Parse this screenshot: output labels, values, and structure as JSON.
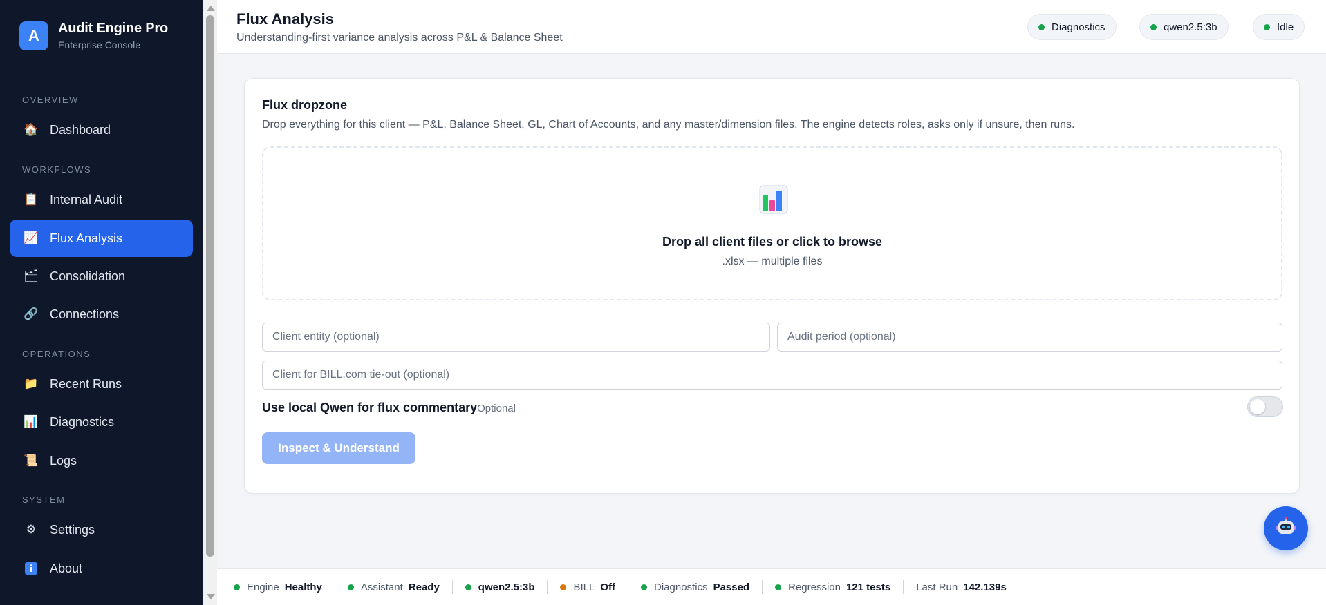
{
  "brand": {
    "logo_letter": "A",
    "name": "Audit Engine Pro",
    "subtitle": "Enterprise Console"
  },
  "sidebar": {
    "sections": [
      {
        "label": "OVERVIEW"
      },
      {
        "label": "WORKFLOWS"
      },
      {
        "label": "OPERATIONS"
      },
      {
        "label": "SYSTEM"
      }
    ],
    "items": [
      {
        "label": "Dashboard",
        "icon": "house-icon"
      },
      {
        "label": "Internal Audit",
        "icon": "clipboard-icon"
      },
      {
        "label": "Flux Analysis",
        "icon": "chart-up-icon",
        "active": true
      },
      {
        "label": "Consolidation",
        "icon": "folder-icon"
      },
      {
        "label": "Connections",
        "icon": "link-icon"
      },
      {
        "label": "Recent Runs",
        "icon": "folder-open-icon"
      },
      {
        "label": "Diagnostics",
        "icon": "bar-chart-icon"
      },
      {
        "label": "Logs",
        "icon": "scroll-icon"
      },
      {
        "label": "Settings",
        "icon": "gear-icon"
      },
      {
        "label": "About",
        "icon": "info-icon"
      }
    ]
  },
  "header": {
    "title": "Flux Analysis",
    "subtitle": "Understanding-first variance analysis across P&L & Balance Sheet",
    "pills": [
      {
        "label": "Diagnostics",
        "status": "green"
      },
      {
        "label": "qwen2.5:3b",
        "status": "green"
      },
      {
        "label": "Idle",
        "status": "green"
      }
    ]
  },
  "card": {
    "title": "Flux dropzone",
    "description": "Drop everything for this client — P&L, Balance Sheet, GL, Chart of Accounts, and any master/dimension files. The engine detects roles, asks only if unsure, then runs.",
    "dropzone": {
      "icon": "bar-chart-icon",
      "title": "Drop all client files or click to browse",
      "subtitle": ".xlsx — multiple files"
    },
    "fields": {
      "client_entity_placeholder": "Client entity (optional)",
      "audit_period_placeholder": "Audit period (optional)",
      "bill_client_placeholder": "Client for BILL.com tie-out (optional)"
    },
    "qwen": {
      "label": "Use local Qwen for flux commentary",
      "optional": "Optional",
      "enabled": false
    },
    "inspect_button": "Inspect & Understand"
  },
  "assistant_fab": {
    "icon": "robot-icon"
  },
  "statusbar": [
    {
      "label": "Engine",
      "value": "Healthy",
      "status": "green"
    },
    {
      "label": "Assistant",
      "value": "Ready",
      "status": "green"
    },
    {
      "label": "",
      "value": "qwen2.5:3b",
      "status": "green"
    },
    {
      "label": "BILL",
      "value": "Off",
      "status": "orange"
    },
    {
      "label": "Diagnostics",
      "value": "Passed",
      "status": "green"
    },
    {
      "label": "Regression",
      "value": "121 tests",
      "status": "green"
    },
    {
      "label": "Last Run",
      "value": "142.139s",
      "status": "none"
    }
  ],
  "colors": {
    "accent": "#2563eb",
    "sidebar_bg": "#0f172a",
    "ok": "#16a34a",
    "warn": "#d97706"
  }
}
